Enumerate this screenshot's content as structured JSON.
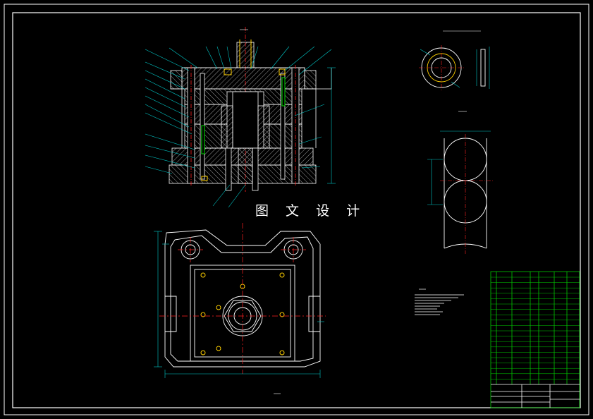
{
  "watermark": "图 文 设 计",
  "colors": {
    "background": "#000000",
    "outline": "#ffffff",
    "centerline": "#ff2020",
    "dimension": "#00c8c8",
    "hatch": "#c8c8c8",
    "spring": "#00e000",
    "part": "#ffd000",
    "table": "#00c800"
  }
}
